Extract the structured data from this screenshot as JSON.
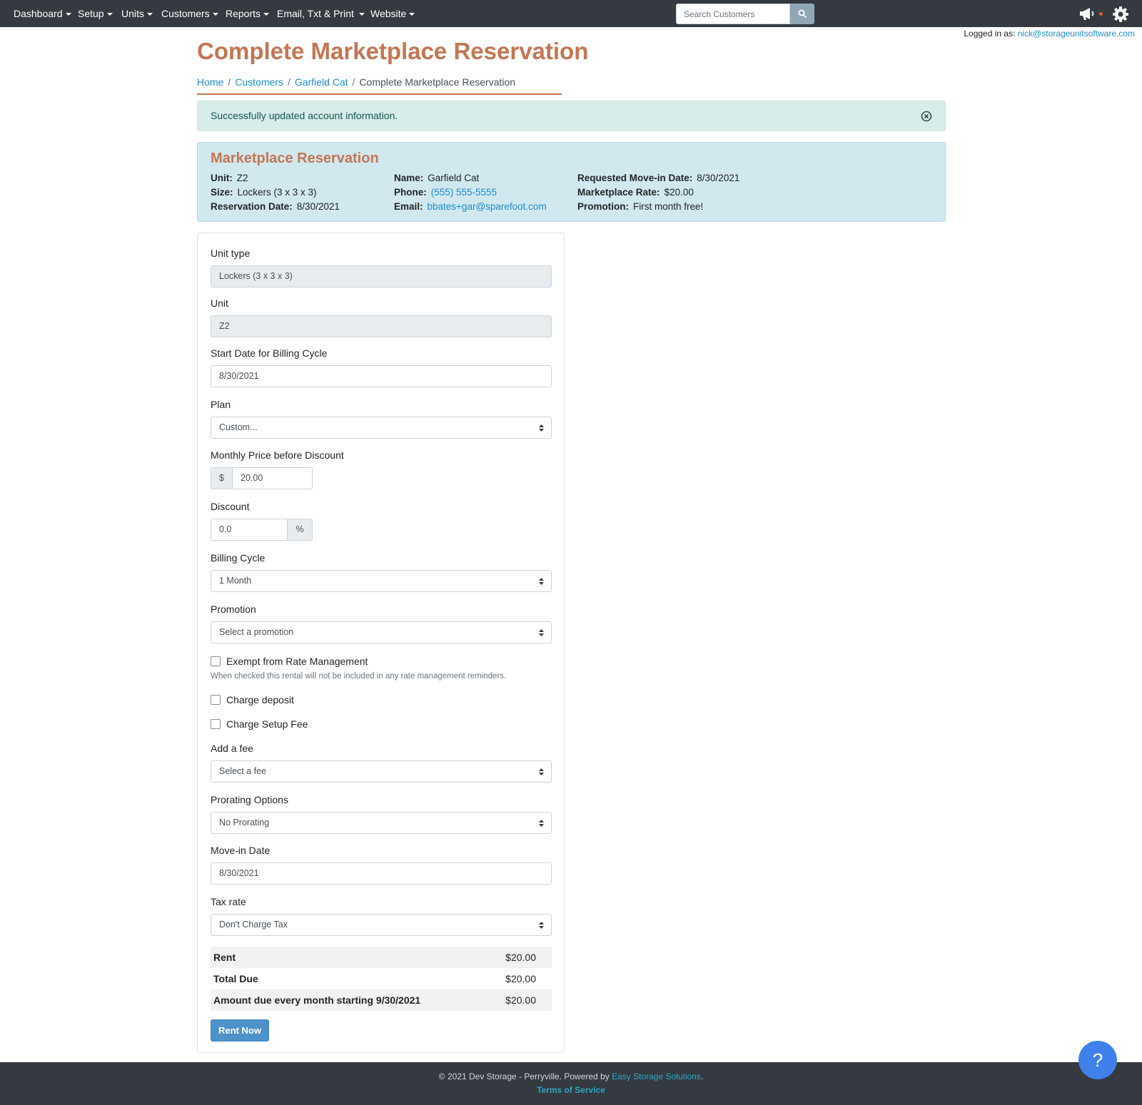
{
  "nav": {
    "items": [
      "Dashboard",
      "Setup",
      "Units",
      "Customers",
      "Reports",
      "Email, Txt & Print",
      "Website"
    ],
    "search_placeholder": "Search Customers"
  },
  "header": {
    "logged_in_label": "Logged in as:",
    "logged_in_email": "nick@storageunitsoftware.com"
  },
  "page": {
    "title": "Complete Marketplace Reservation",
    "breadcrumb": [
      "Home",
      "Customers",
      "Garfield Cat",
      "Complete Marketplace Reservation"
    ]
  },
  "alert": {
    "message": "Successfully updated account information."
  },
  "reservation": {
    "title": "Marketplace Reservation",
    "unit_label": "Unit:",
    "unit": "Z2",
    "size_label": "Size:",
    "size": "Lockers (3 x 3 x 3)",
    "reservation_date_label": "Reservation Date:",
    "reservation_date": "8/30/2021",
    "name_label": "Name:",
    "name": "Garfield Cat",
    "phone_label": "Phone:",
    "phone": "(555) 555-5555",
    "email_label": "Email:",
    "email": "bbates+gar@sparefoot.com",
    "move_in_label": "Requested Move-in Date:",
    "move_in": "8/30/2021",
    "rate_label": "Marketplace Rate:",
    "rate": "$20.00",
    "promotion_label": "Promotion:",
    "promotion": "First month free!"
  },
  "form": {
    "unit_type_label": "Unit type",
    "unit_type": "Lockers (3 x 3 x 3)",
    "unit_label": "Unit",
    "unit": "Z2",
    "start_date_label": "Start Date for Billing Cycle",
    "start_date": "8/30/2021",
    "plan_label": "Plan",
    "plan": "Custom...",
    "monthly_price_label": "Monthly Price before Discount",
    "currency_symbol": "$",
    "monthly_price": "20.00",
    "discount_label": "Discount",
    "discount": "0.0",
    "percent_symbol": "%",
    "billing_cycle_label": "Billing Cycle",
    "billing_cycle": "1 Month",
    "promotion_label": "Promotion",
    "promotion": "Select a promotion",
    "exempt_label": "Exempt from Rate Management",
    "exempt_help": "When checked this rental will not be included in any rate management reminders.",
    "charge_deposit_label": "Charge deposit",
    "charge_setup_label": "Charge Setup Fee",
    "add_fee_label": "Add a fee",
    "add_fee": "Select a fee",
    "prorating_label": "Prorating Options",
    "prorating": "No Prorating",
    "move_in_label": "Move-in Date",
    "move_in": "8/30/2021",
    "tax_label": "Tax rate",
    "tax": "Don't Charge Tax"
  },
  "summary": [
    {
      "label": "Rent",
      "value": "$20.00"
    },
    {
      "label": "Total Due",
      "value": "$20.00"
    },
    {
      "label": "Amount due every month starting 9/30/2021",
      "value": "$20.00"
    }
  ],
  "actions": {
    "rent_now": "Rent Now"
  },
  "footer": {
    "copyright": "© 2021 Dev Storage - Perryville. Powered by",
    "powered_link": "Easy Storage Solutions",
    "period": ".",
    "terms": "Terms of Service"
  },
  "help_button": "?",
  "colors": {
    "navbar": "#343a40",
    "accent": "#c47653",
    "link": "#1f8ccb",
    "alert_bg": "#d7ede9",
    "info_bg": "#d0e8ee",
    "primary_button": "#4d92c8",
    "help_bubble": "#3f80ea"
  }
}
